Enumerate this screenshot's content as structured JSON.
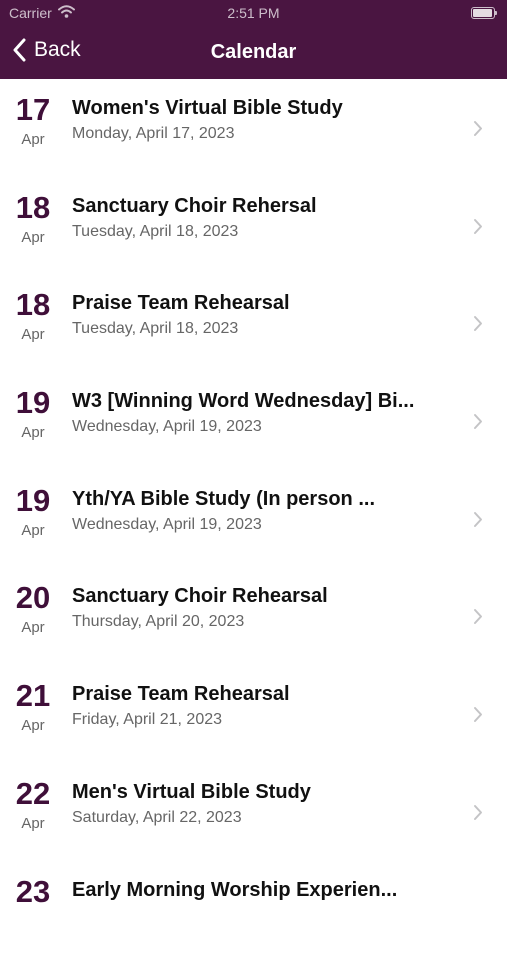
{
  "status_bar": {
    "carrier": "Carrier",
    "time": "2:51 PM",
    "icons": [
      "wifi-icon",
      "battery-icon"
    ]
  },
  "nav": {
    "back_label": "Back",
    "title": "Calendar",
    "background_color": "#4a1541"
  },
  "events": [
    {
      "day": "17",
      "month": "Apr",
      "title": "Women's Virtual Bible Study",
      "date": "Monday, April 17, 2023"
    },
    {
      "day": "18",
      "month": "Apr",
      "title": "Sanctuary Choir Rehersal",
      "date": "Tuesday, April 18, 2023"
    },
    {
      "day": "18",
      "month": "Apr",
      "title": "Praise Team Rehearsal",
      "date": "Tuesday, April 18, 2023"
    },
    {
      "day": "19",
      "month": "Apr",
      "title": "W3 [Winning Word Wednesday] Bi...",
      "date": "Wednesday, April 19, 2023"
    },
    {
      "day": "19",
      "month": "Apr",
      "title": "Yth/YA Bible Study (In person ...",
      "date": "Wednesday, April 19, 2023"
    },
    {
      "day": "20",
      "month": "Apr",
      "title": "Sanctuary Choir Rehearsal",
      "date": "Thursday, April 20, 2023"
    },
    {
      "day": "21",
      "month": "Apr",
      "title": "Praise Team Rehearsal",
      "date": "Friday, April 21, 2023"
    },
    {
      "day": "22",
      "month": "Apr",
      "title": "Men's Virtual Bible Study",
      "date": "Saturday, April 22, 2023"
    },
    {
      "day": "23",
      "month": "",
      "title": "Early Morning Worship Experien...",
      "date": ""
    }
  ]
}
